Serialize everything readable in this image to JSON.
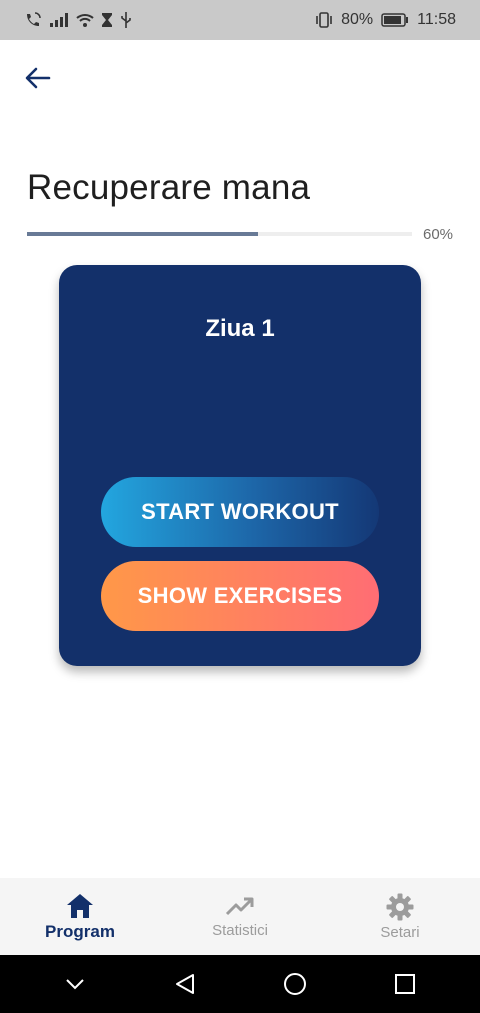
{
  "status_bar": {
    "battery": "80%",
    "time": "11:58",
    "icons": [
      "phone-wifi-icon",
      "signal-icon",
      "wifi-icon",
      "hourglass-icon",
      "usb-icon",
      "vibrate-icon",
      "battery-icon"
    ]
  },
  "header": {
    "back_icon": "arrow-left-icon",
    "title": "Recuperare mana"
  },
  "progress": {
    "value": 0.6,
    "label": "60%"
  },
  "card": {
    "day_title": "Ziua 1",
    "start_button": "START WORKOUT",
    "show_button": "SHOW EXERCISES",
    "colors": {
      "card_bg": "#13306a",
      "start_gradient": [
        "#23a6df",
        "#143876"
      ],
      "show_gradient": [
        "#ff9848",
        "#ff6d74"
      ]
    }
  },
  "bottom_nav": {
    "items": [
      {
        "label": "Program",
        "icon": "home-icon",
        "active": true
      },
      {
        "label": "Statistici",
        "icon": "trending-up-icon",
        "active": false
      },
      {
        "label": "Setari",
        "icon": "gear-icon",
        "active": false
      }
    ]
  },
  "system_nav": {
    "icons": [
      "chevron-down-icon",
      "back-triangle-icon",
      "home-circle-icon",
      "recents-square-icon"
    ]
  }
}
